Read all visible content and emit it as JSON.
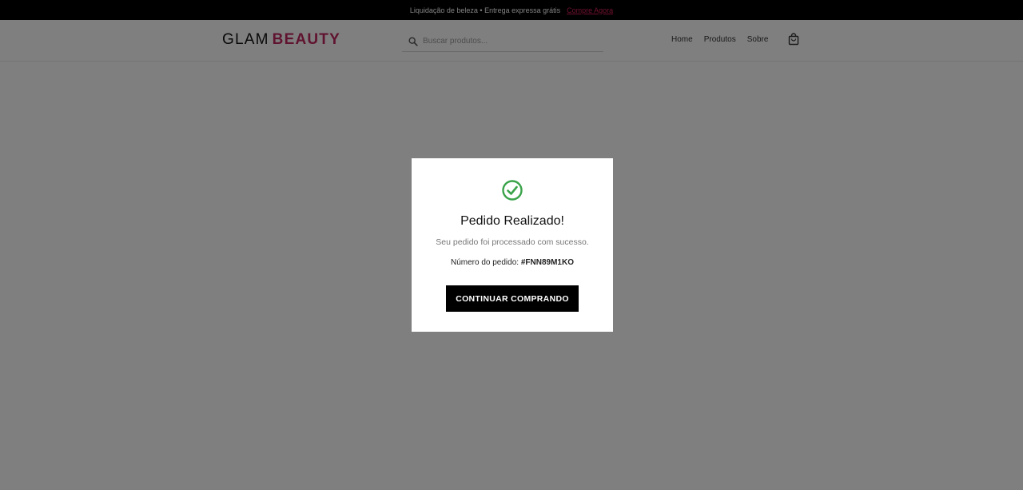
{
  "promo": {
    "text": "Liquidação de beleza • Entrega expressa grátis",
    "link": "Compre Agora"
  },
  "header": {
    "logo_part1": "GLAM",
    "logo_part2": "BEAUTY",
    "search_placeholder": "Buscar produtos...",
    "nav": [
      "Home",
      "Produtos",
      "Sobre"
    ],
    "bag_icon": "shopping-bag-icon"
  },
  "modal": {
    "icon": "check-circle-icon",
    "title": "Pedido Realizado!",
    "message": "Seu pedido foi processado com sucesso.",
    "order_label": "Número do pedido:",
    "order_number": "#FNN89M1KO",
    "button": "CONTINUAR COMPRANDO"
  },
  "colors": {
    "brand": "#c0265f",
    "success": "#3aa34a",
    "overlay": "rgba(0,0,0,0.5)"
  }
}
